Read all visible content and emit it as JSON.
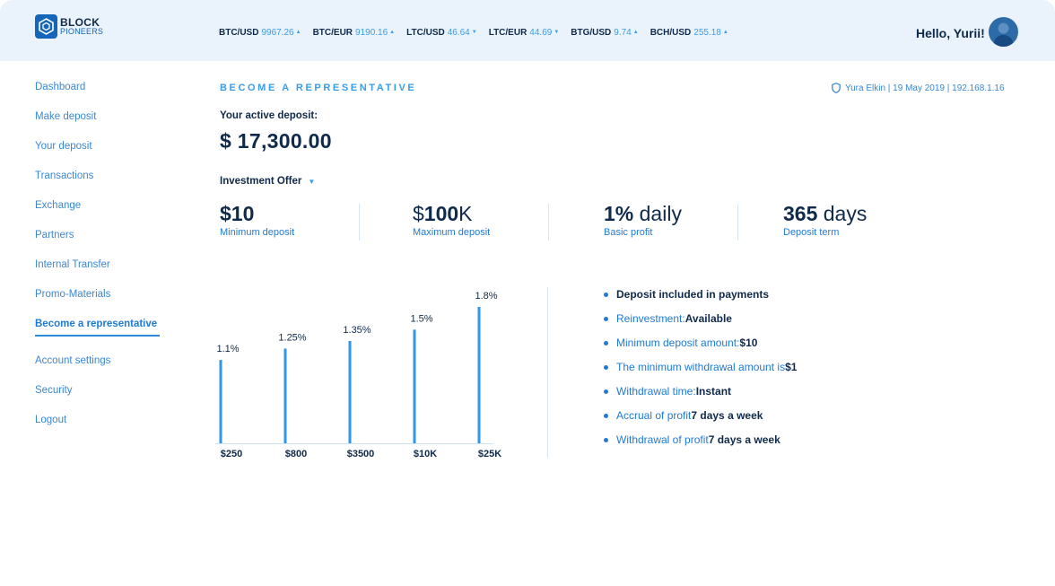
{
  "header": {
    "logo": {
      "line1": "BLOCK",
      "line2": "PIONEERS"
    },
    "tickers": [
      {
        "pair": "BTC/USD",
        "price": "9967.26",
        "trend": "up"
      },
      {
        "pair": "BTC/EUR",
        "price": "9190.16",
        "trend": "up"
      },
      {
        "pair": "LTC/USD",
        "price": "46.64",
        "trend": "down"
      },
      {
        "pair": "LTC/EUR",
        "price": "44.69",
        "trend": "down"
      },
      {
        "pair": "BTG/USD",
        "price": "9.74",
        "trend": "up"
      },
      {
        "pair": "BCH/USD",
        "price": "255.18",
        "trend": "up"
      }
    ],
    "greeting": "Hello, Yurii!"
  },
  "sidebar": {
    "items": [
      {
        "label": "Dashboard"
      },
      {
        "label": "Make deposit"
      },
      {
        "label": "Your deposit"
      },
      {
        "label": "Transactions"
      },
      {
        "label": "Exchange"
      },
      {
        "label": "Partners"
      },
      {
        "label": "Internal Transfer"
      },
      {
        "label": "Promo-Materials"
      },
      {
        "label": "Become a representative",
        "active": true
      },
      {
        "label": "Account settings"
      },
      {
        "label": "Security"
      },
      {
        "label": "Logout"
      }
    ]
  },
  "main": {
    "title": "BECOME A REPRESENTATIVE",
    "meta": "Yura Elkin | 19 May 2019 | 192.168.1.16",
    "deposit_label": "Your active deposit:",
    "deposit_value": "$ 17,300.00",
    "offer_label": "Investment Offer",
    "stats": [
      {
        "bold": "$10",
        "rest": "",
        "prefix": "",
        "label": "Minimum deposit"
      },
      {
        "prefix": "$",
        "bold": "100",
        "rest": "K",
        "label": "Maximum deposit"
      },
      {
        "prefix": "",
        "bold": "1%",
        "rest": " daily",
        "label": "Basic profit"
      },
      {
        "prefix": "",
        "bold": "365",
        "rest": " days",
        "label": "Deposit term"
      }
    ],
    "features": [
      {
        "text": "Deposit included in payments",
        "strong": "",
        "all_bold": true
      },
      {
        "text": "Reinvestment: ",
        "strong": "Available"
      },
      {
        "text": "Minimum deposit amount: ",
        "strong": "$10"
      },
      {
        "text": "The minimum withdrawal amount is ",
        "strong": "$1"
      },
      {
        "text": "Withdrawal time: ",
        "strong": "Instant"
      },
      {
        "text": "Accrual of profit ",
        "strong": "7 days a week"
      },
      {
        "text": "Withdrawal of profit ",
        "strong": "7 days a week"
      }
    ]
  },
  "chart_data": {
    "type": "bar",
    "categories": [
      "$250",
      "$800",
      "$3500",
      "$10K",
      "$25K"
    ],
    "values": [
      1.1,
      1.25,
      1.35,
      1.5,
      1.8
    ],
    "value_labels": [
      "1.1%",
      "1.25%",
      "1.35%",
      "1.5%",
      "1.8%"
    ],
    "title": "",
    "xlabel": "",
    "ylabel": "",
    "ylim": [
      0,
      1.8
    ],
    "grid": false,
    "bar_color": "#2f96ea"
  },
  "colors": {
    "accent": "#3a9de8",
    "link": "#1f7ad3",
    "text_dark": "#0f2a4a",
    "header_bg": "#eaf3fb"
  }
}
